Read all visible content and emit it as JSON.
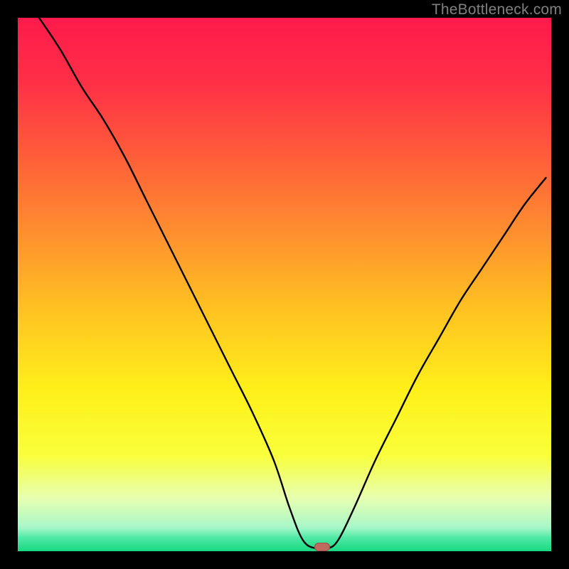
{
  "watermark": "TheBottleneck.com",
  "colors": {
    "frame": "#000000",
    "curve": "#000000",
    "marker_fill": "#bf6a5e",
    "marker_stroke": "#a24f43",
    "gradient_stops": [
      {
        "pos": 0.0,
        "color": "#ff1a4b"
      },
      {
        "pos": 0.12,
        "color": "#ff2f47"
      },
      {
        "pos": 0.25,
        "color": "#ff5a3a"
      },
      {
        "pos": 0.4,
        "color": "#ff8e2f"
      },
      {
        "pos": 0.55,
        "color": "#ffc321"
      },
      {
        "pos": 0.7,
        "color": "#fff01a"
      },
      {
        "pos": 0.82,
        "color": "#f8ff3a"
      },
      {
        "pos": 0.9,
        "color": "#e8ffb0"
      },
      {
        "pos": 0.955,
        "color": "#a8f7c9"
      },
      {
        "pos": 0.975,
        "color": "#4fe8a6"
      },
      {
        "pos": 1.0,
        "color": "#17d881"
      }
    ]
  },
  "chart_data": {
    "type": "line",
    "title": "",
    "xlabel": "",
    "ylabel": "",
    "xlim": [
      0,
      100
    ],
    "ylim": [
      0,
      100
    ],
    "series": [
      {
        "name": "bottleneck-curve",
        "x": [
          4,
          8,
          12,
          16,
          20,
          24,
          28,
          32,
          36,
          40,
          44,
          48,
          51,
          53.5,
          56,
          58,
          60,
          63,
          67,
          71,
          75,
          79,
          83,
          87,
          91,
          95,
          99
        ],
        "y": [
          100,
          94,
          87,
          81,
          74,
          66,
          58,
          50,
          42,
          34,
          26,
          17,
          8,
          2,
          0.5,
          0.5,
          2,
          8,
          17,
          25,
          33,
          40,
          47,
          53,
          59,
          65,
          70
        ]
      }
    ],
    "marker": {
      "x": 57,
      "y": 0.8
    },
    "annotations": []
  }
}
